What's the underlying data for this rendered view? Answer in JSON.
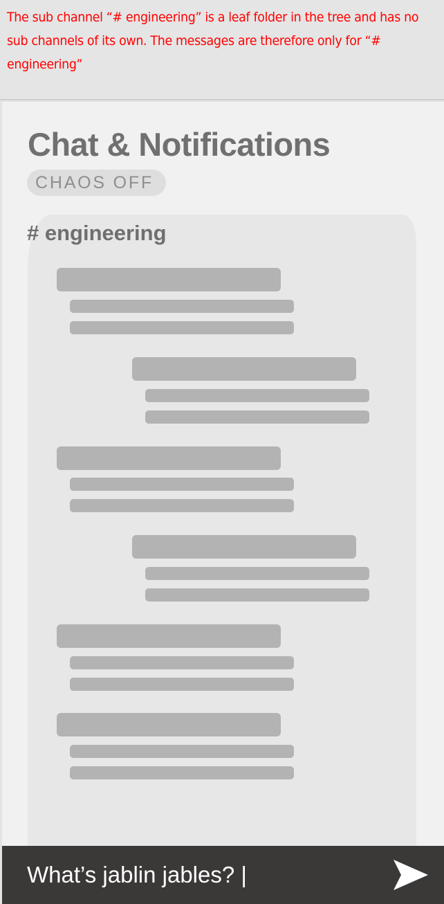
{
  "annotation": {
    "text": "The sub channel “# engineering” is a leaf folder in the tree and has no sub channels of its own. The messages are therefore only for “# engineering”"
  },
  "header": {
    "title": "Chat & Notifications",
    "chaos_badge": "CHAOS OFF"
  },
  "channel": {
    "name": "# engineering"
  },
  "chat_input": {
    "value": "What’s jablin jables? |"
  },
  "icons": {
    "send": "send-arrow-icon"
  },
  "colors": {
    "annotation_text": "#ff0000",
    "title_text": "#707070",
    "badge_text": "#8e8e8e",
    "channel_text": "#6f6f6f",
    "placeholder_bar": "#b4b3b4",
    "input_bar_background": "#3b3838",
    "input_text": "#ffffff"
  }
}
